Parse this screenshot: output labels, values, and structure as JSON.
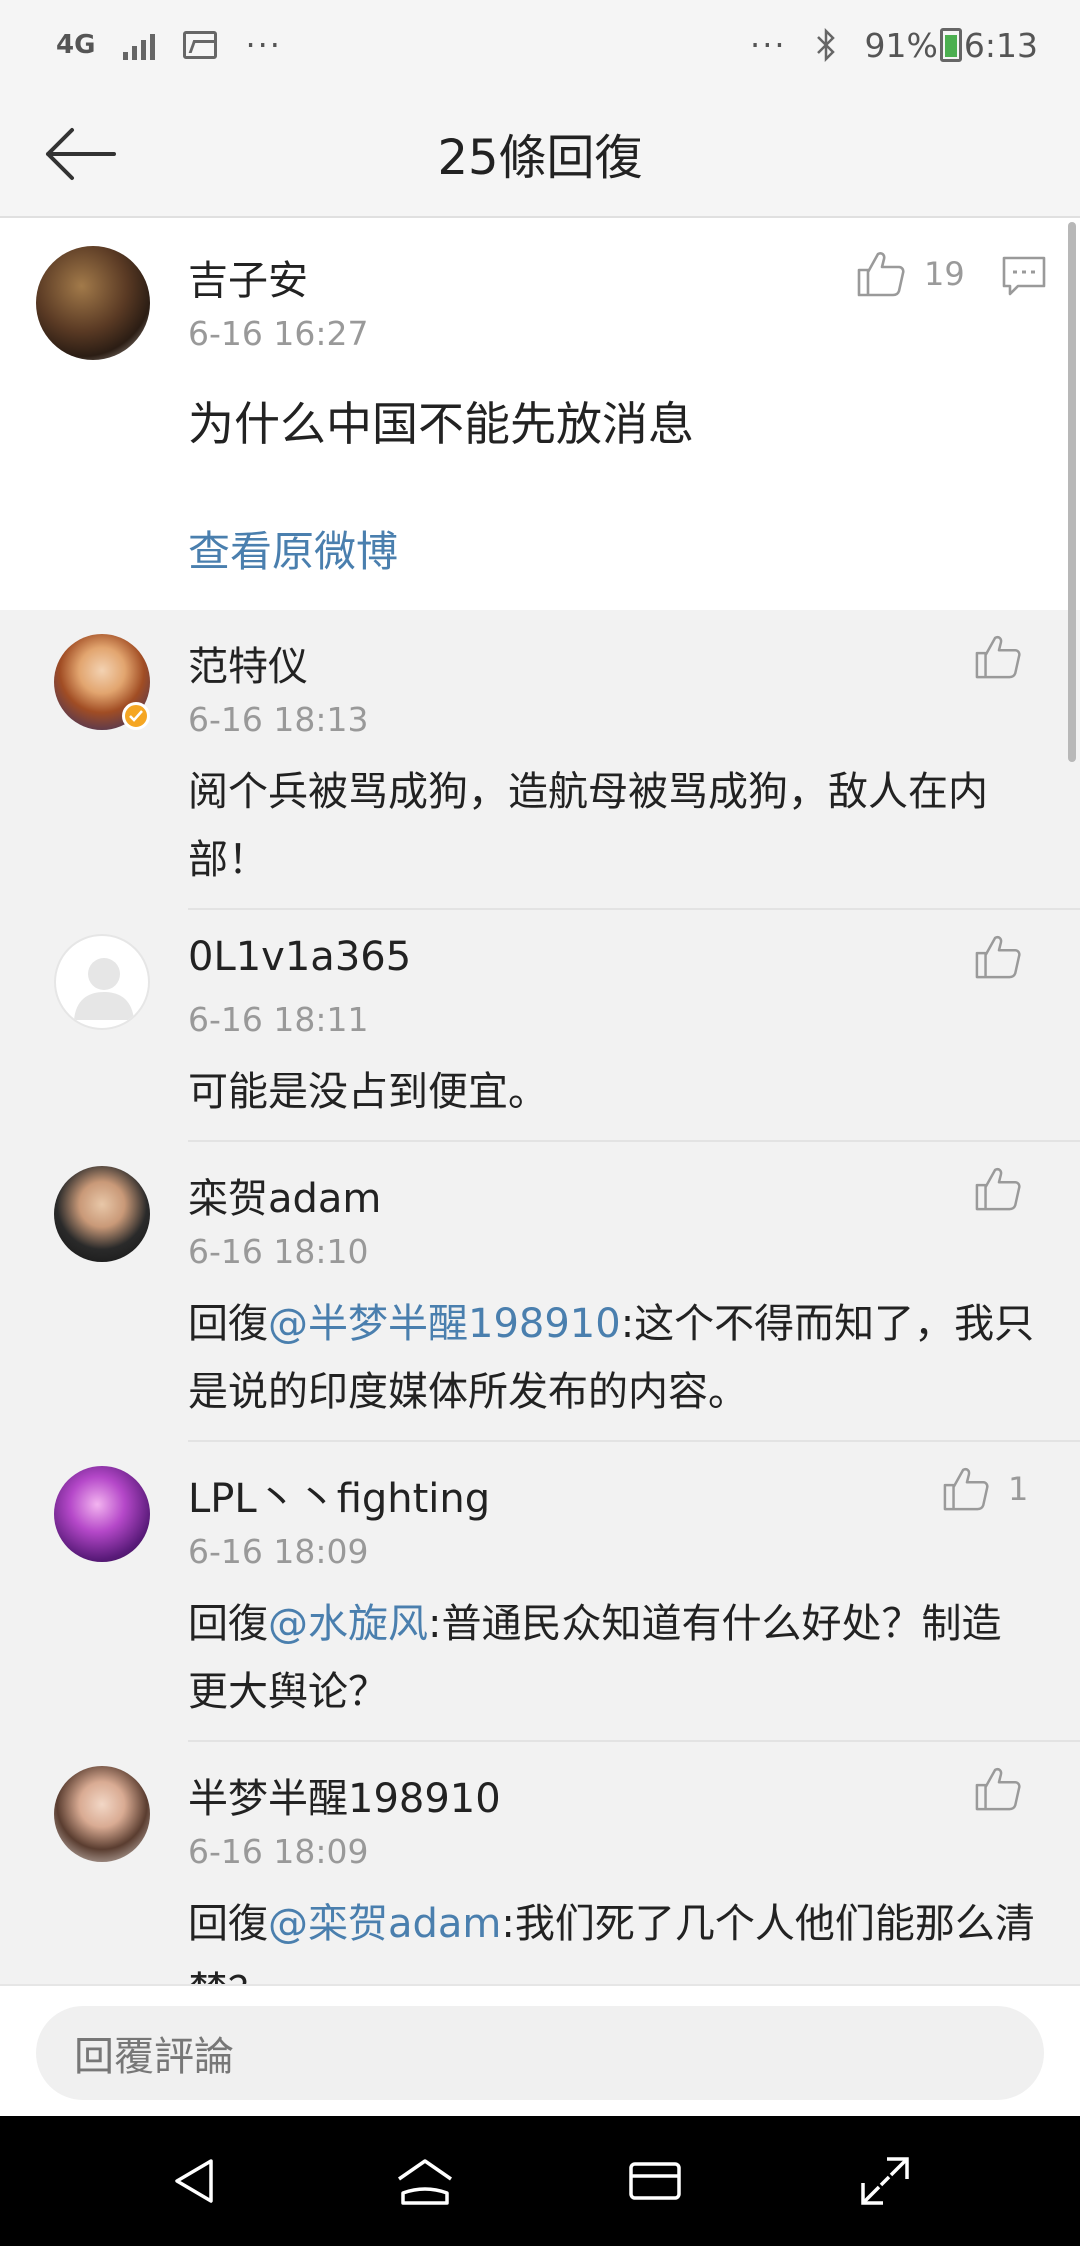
{
  "status_bar": {
    "network": "4G",
    "dots_left": "···",
    "dots_right": "···",
    "battery": "91%",
    "time": "6:13",
    "icons": [
      "signal-icon",
      "gallery-icon",
      "bluetooth-icon",
      "battery-icon"
    ],
    "battery_level": 0.91,
    "battery_color": "#4caf50"
  },
  "header": {
    "title": "25條回復",
    "back_icon": "back-arrow-icon"
  },
  "post": {
    "user": "吉子安",
    "time": "6-16 16:27",
    "text": "为什么中国不能先放消息",
    "likes": "19",
    "view_original": "查看原微博",
    "like_icon": "thumbs-up-icon",
    "comment_icon": "comment-icon"
  },
  "replies": [
    {
      "user": "范特仪",
      "time": "6-16 18:13",
      "text": "阅个兵被骂成狗，造航母被骂成狗，敌人在内部！",
      "likes": "",
      "verified": true
    },
    {
      "user": "0L1v1a365",
      "time": "6-16 18:11",
      "text": "可能是没占到便宜。",
      "likes": ""
    },
    {
      "user": "栾贺adam",
      "time": "6-16 18:10",
      "prefix": "回復",
      "mention": "@半梦半醒198910",
      "text": ":这个不得而知了，我只是说的印度媒体所发布的内容。",
      "likes": ""
    },
    {
      "user": "LPL丶丶fighting",
      "time": "6-16 18:09",
      "prefix": "回復",
      "mention": "@水旋风",
      "text": ":普通民众知道有什么好处？制造更大舆论？",
      "likes": "1"
    },
    {
      "user": "半梦半醒198910",
      "time": "6-16 18:09",
      "prefix": "回復",
      "mention": "@栾贺adam",
      "text": ":我们死了几个人他们能那么清楚？",
      "likes": ""
    }
  ],
  "reply_bar": {
    "placeholder": "回覆評論"
  },
  "nav_bar": {
    "icons": [
      "nav-back-icon",
      "nav-home-icon",
      "nav-recents-icon",
      "nav-expand-icon"
    ]
  },
  "colors": {
    "link": "#4a7fae",
    "secondary_text": "#999999",
    "background": "#f2f2f2",
    "verified_badge": "#f5a623"
  }
}
